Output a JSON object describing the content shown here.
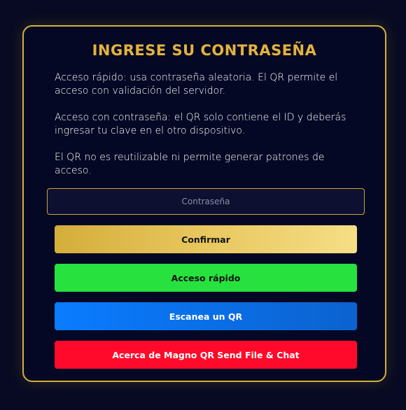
{
  "dialog": {
    "title": "INGRESE SU CONTRASEÑA",
    "paragraphs": [
      "Acceso rápido: usa contraseña aleatoria. El QR permite el acceso con validación del servidor.",
      "Acceso con contraseña: el QR solo contiene el ID y deberás ingresar tu clave en el otro dispositivo.",
      "El QR no es reutilizable ni permite generar patrones de acceso."
    ],
    "password": {
      "value": "",
      "placeholder": "Contraseña"
    },
    "buttons": {
      "confirm": "Confirmar",
      "quick_access": "Acceso rápido",
      "scan_qr": "Escanea un QR",
      "about": "Acerca de Magno QR Send File & Chat"
    }
  },
  "colors": {
    "background": "#070a22",
    "card_border": "#d4af37",
    "title": "#e3b43c",
    "confirm_start": "#d4ae3b",
    "confirm_end": "#f5de86",
    "quick_access": "#27e23e",
    "scan_qr": "#0a7cff",
    "about": "#ff0a2a"
  }
}
